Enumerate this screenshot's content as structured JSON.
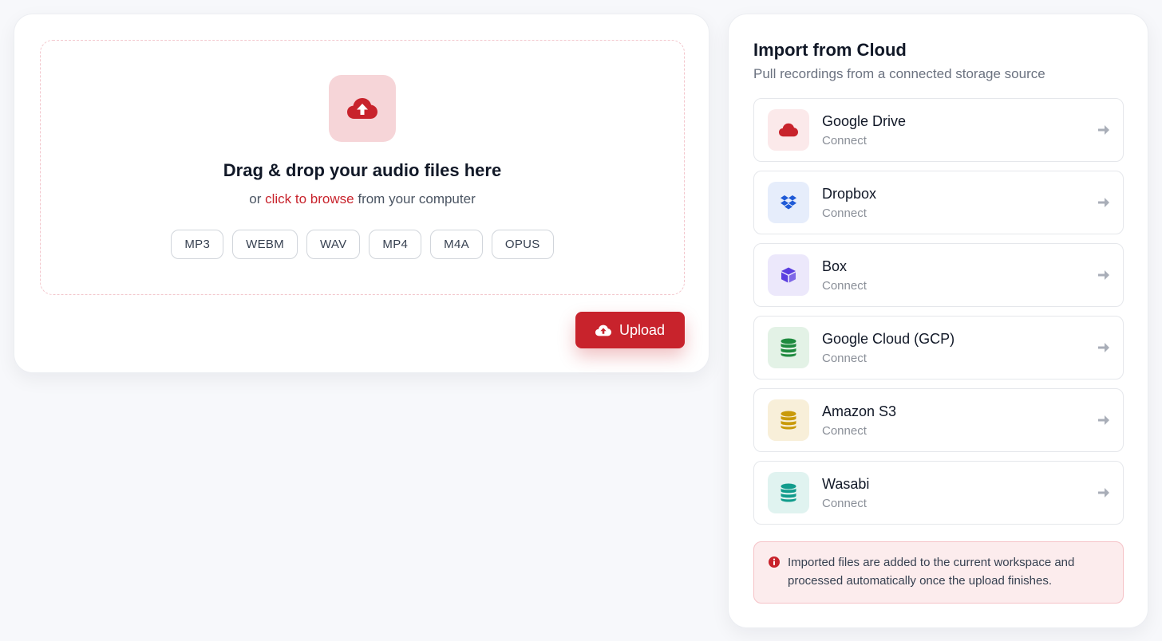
{
  "upload": {
    "title": "Drag & drop your audio files here",
    "sub_prefix": "or",
    "browse_link": "click to browse",
    "sub_suffix": "from your computer",
    "formats": [
      "MP3",
      "WEBM",
      "WAV",
      "MP4",
      "M4A",
      "OPUS"
    ],
    "button_label": "Upload",
    "icon": "cloud-upload-icon"
  },
  "cloud": {
    "title": "Import from Cloud",
    "subtitle": "Pull recordings from a connected storage source",
    "providers": [
      {
        "name": "Google Drive",
        "action": "Connect",
        "icon": "cloud-icon",
        "color": "#c8232c",
        "bg": "#fbe9ea"
      },
      {
        "name": "Dropbox",
        "action": "Connect",
        "icon": "dropbox-icon",
        "color": "#1f5ad6",
        "bg": "#e6edfb"
      },
      {
        "name": "Box",
        "action": "Connect",
        "icon": "cube-icon",
        "color": "#5b3ee0",
        "bg": "#ece8fb"
      },
      {
        "name": "Google Cloud (GCP)",
        "action": "Connect",
        "icon": "database-icon",
        "color": "#1e8a3e",
        "bg": "#e3f2e6"
      },
      {
        "name": "Amazon S3",
        "action": "Connect",
        "icon": "database-icon",
        "color": "#c99a0a",
        "bg": "#f8efd9"
      },
      {
        "name": "Wasabi",
        "action": "Connect",
        "icon": "database-icon",
        "color": "#119c8c",
        "bg": "#e0f3f0"
      }
    ],
    "info_text": "Imported files are added to the current workspace and processed automatically once the upload finishes."
  },
  "colors": {
    "accent": "#c8232c",
    "page_bg": "#f7f8fb"
  }
}
